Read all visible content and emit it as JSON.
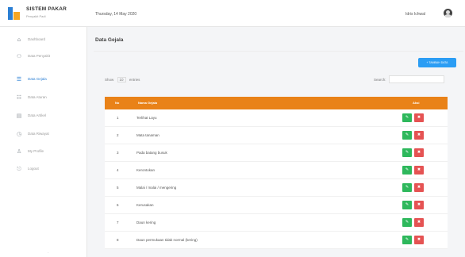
{
  "brand": {
    "title": "SISTEM PAKAR",
    "subtitle": "Penyakit Padi"
  },
  "header": {
    "date": "Thursday, 14 May 2020",
    "user": "Idris Ichwal"
  },
  "sidebar": {
    "items": [
      {
        "label": "Dashboard",
        "icon": "dashboard-icon",
        "glyph": "⌂"
      },
      {
        "label": "Data Penyakit",
        "icon": "disease-icon",
        "glyph": "⚇"
      },
      {
        "label": "Data Gejala",
        "icon": "symptom-icon",
        "glyph": "☰"
      },
      {
        "label": "Data Aturan",
        "icon": "rules-icon",
        "glyph": "☷"
      },
      {
        "label": "Data Artikel",
        "icon": "article-icon",
        "glyph": "▤"
      },
      {
        "label": "Data Riwayat",
        "icon": "history-icon",
        "glyph": "◷"
      },
      {
        "label": "My Profile",
        "icon": "profile-icon",
        "glyph": "♙"
      },
      {
        "label": "Logout",
        "icon": "logout-icon",
        "glyph": "⎋"
      }
    ],
    "active_index": 2
  },
  "main": {
    "title": "Data Gejala",
    "add_button": "+ TAMBAH DATA",
    "show_label": "Show",
    "entries_value": "10",
    "entries_label": "entries",
    "search_label": "Search:"
  },
  "table": {
    "headers": {
      "no": "No",
      "name": "Nama Gejala",
      "action": "Aksi"
    },
    "rows": [
      {
        "no": "1",
        "name": "Terlihat Layu"
      },
      {
        "no": "2",
        "name": "Mata tanaman"
      },
      {
        "no": "3",
        "name": "Pada batang busuk"
      },
      {
        "no": "4",
        "name": "Kerontokan"
      },
      {
        "no": "5",
        "name": "Malai / malai / mengering"
      },
      {
        "no": "6",
        "name": "Kerusakan"
      },
      {
        "no": "7",
        "name": "Daun kering"
      },
      {
        "no": "8",
        "name": "Daun permukaan tidak normal (kering)"
      }
    ],
    "edit_glyph": "✎",
    "delete_glyph": "✖"
  },
  "colors": {
    "accent": "#2b7fd4",
    "table_header": "#e98218",
    "edit_button": "#2eb85c",
    "delete_button": "#e55353",
    "add_button": "#2b9df4"
  }
}
